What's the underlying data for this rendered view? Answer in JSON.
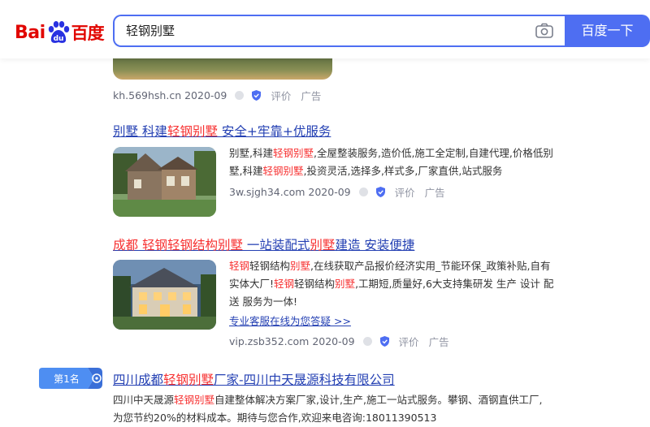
{
  "header": {
    "logo_text_left": "Bai",
    "logo_text_right": "百度",
    "search_value": "轻钢别墅",
    "search_button": "百度一下"
  },
  "result0": {
    "url": "kh.569hsh.cn",
    "date": "2020-09",
    "comment": "评价",
    "ad": "广告"
  },
  "result1": {
    "title_parts": [
      "别墅 科建",
      "轻钢别墅",
      " 安全+牢靠+优服务"
    ],
    "desc_line1": [
      "别墅,科建",
      "轻钢别墅",
      ",全屋整装服务,造价低,施工全定制,自建代理,价格低别"
    ],
    "desc_line2": [
      "墅,科建",
      "轻钢别墅",
      ",投资灵活,选择多,样式多,厂家直供,站式服务"
    ],
    "url": "3w.sjgh34.com",
    "date": "2020-09",
    "comment": "评价",
    "ad": "广告"
  },
  "result2": {
    "title_parts": [
      "成都",
      " 轻钢",
      "轻钢结构",
      "别墅",
      " 一站装配式",
      "别墅",
      "建造 安装便捷"
    ],
    "desc_line1": [
      "轻钢",
      "轻钢结构",
      "别墅",
      ",在线获取产品报价经济实用_节能环保_政策补贴,自有"
    ],
    "desc_line2": [
      "实体大厂!",
      "轻钢",
      "轻钢结构",
      "别墅",
      ",工期短,质量好,6大支持集研发 生产 设计 配"
    ],
    "desc_line3": "送 服务为一体!",
    "link": "专业客服在线为您答疑 >>",
    "url": "vip.zsb352.com",
    "date": "2020-09",
    "comment": "评价",
    "ad": "广告"
  },
  "result3": {
    "rank_label": "第1名",
    "title_parts": [
      "四川成都",
      "轻钢别墅",
      "厂家-四川中天晟源科技有限公司"
    ],
    "desc_line1": [
      "四川中天晟源",
      "轻钢别墅",
      "自建整体解决方案厂家,设计,生产,施工一站式服务。攀钢、酒钢直供工厂,"
    ],
    "desc_line2": "为您节约20%的材料成本。期待与您合作,欢迎来电咨询:18011390513"
  },
  "colors": {
    "accent": "#4e6ef2",
    "link": "#2440b3",
    "highlight": "#f73131",
    "logo_red": "#e10601"
  },
  "icons": [
    "camera-icon",
    "baidu-paw-icon",
    "shield-icon",
    "rank-badge-icon"
  ]
}
